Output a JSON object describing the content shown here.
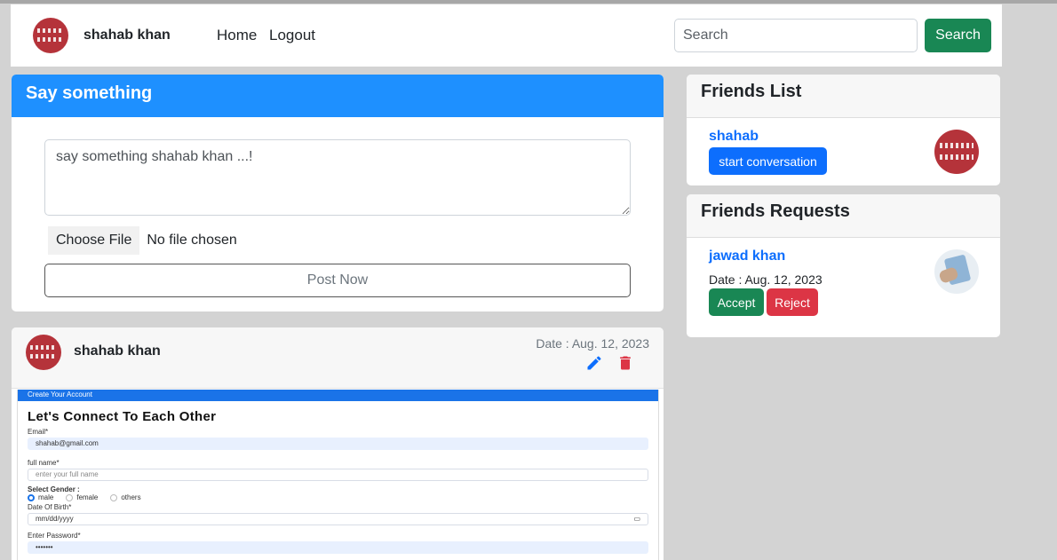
{
  "navbar": {
    "user_name": "shahab khan",
    "links": [
      "Home",
      "Logout"
    ],
    "search_placeholder": "Search",
    "search_button": "Search"
  },
  "post_form": {
    "title": "Say something",
    "textarea_placeholder": "say something shahab khan ...!",
    "choose_file_label": "Choose File",
    "file_status": "No file chosen",
    "post_button": "Post Now"
  },
  "post": {
    "author": "shahab khan",
    "date": "Date : Aug. 12, 2023",
    "image": {
      "bar_text": "Create Your Account",
      "heading": "Let's Connect To Each Other",
      "email_label": "Email*",
      "email_value": "shahab@gmail.com",
      "fullname_label": "full name*",
      "fullname_placeholder": "enter your full name",
      "gender_label": "Select Gender :",
      "gender_options": [
        "male",
        "female",
        "others"
      ],
      "dob_label": "Date Of Birth*",
      "dob_placeholder": "mm/dd/yyyy",
      "password_label": "Enter Password*",
      "password_value": "•••••••"
    }
  },
  "friends_list": {
    "title": "Friends List",
    "friend_name": "shahab",
    "button": "start conversation"
  },
  "friend_requests": {
    "title": "Friends Requests",
    "name": "jawad khan",
    "date": "Date : Aug. 12, 2023",
    "accept": "Accept",
    "reject": "Reject"
  },
  "colors": {
    "primary": "#0d6efd",
    "header_blue": "#1e90ff",
    "success": "#198754",
    "danger": "#dc3545",
    "page_bg": "#d3d3d3"
  },
  "icons": [
    "pencil-icon",
    "trash-icon",
    "calendar-icon"
  ]
}
